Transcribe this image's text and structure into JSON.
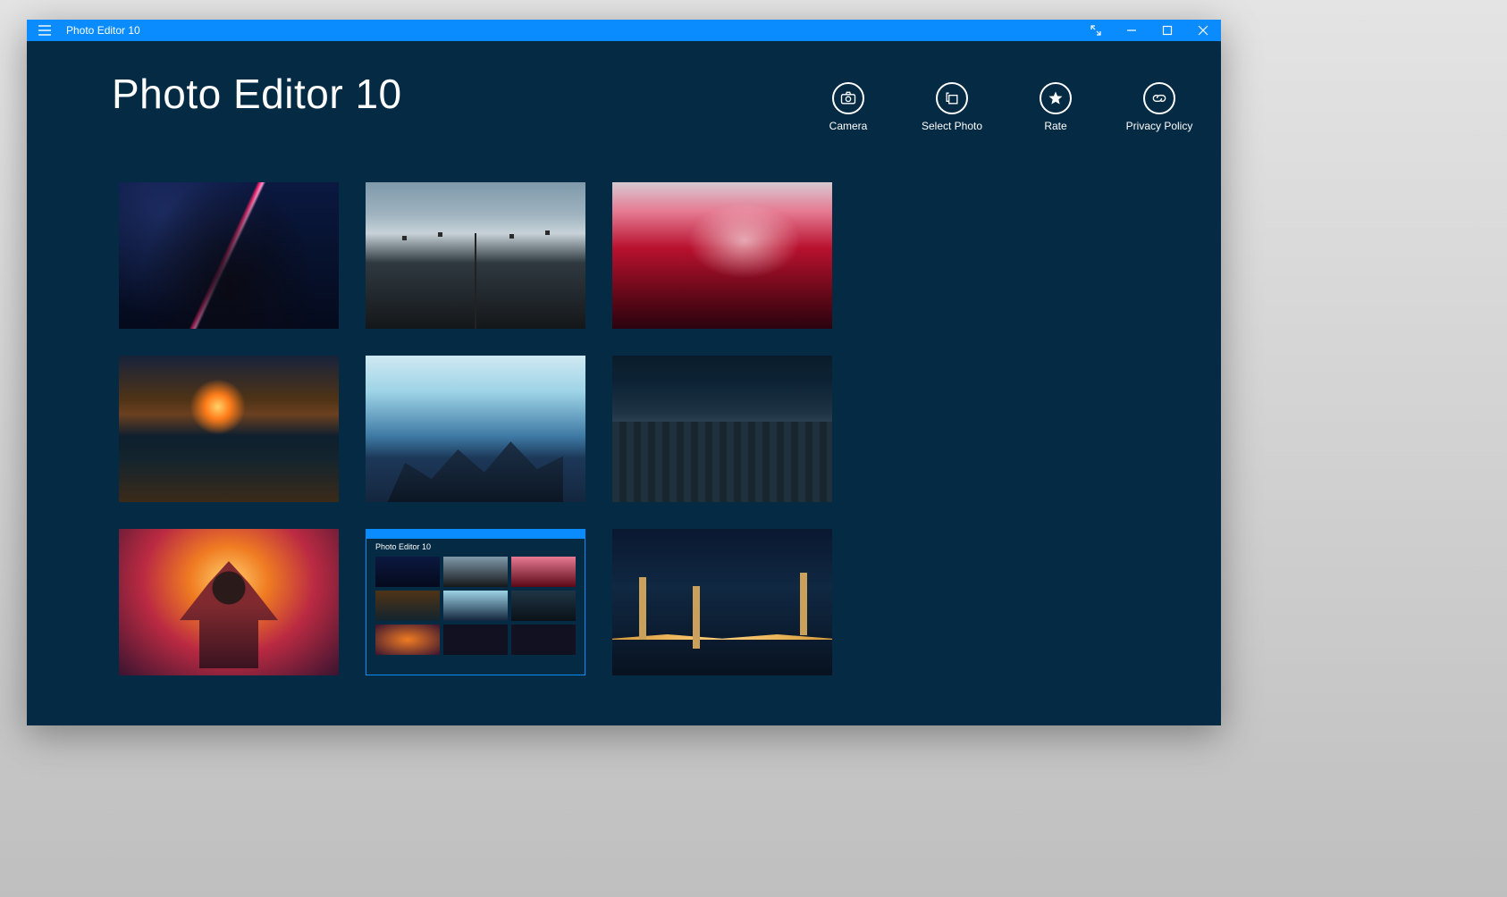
{
  "titlebar": {
    "app_name": "Photo Editor 10"
  },
  "page": {
    "title": "Photo Editor 10"
  },
  "actions": {
    "camera": {
      "label": "Camera"
    },
    "select": {
      "label": "Select Photo"
    },
    "rate": {
      "label": "Rate"
    },
    "privacy": {
      "label": "Privacy Policy"
    }
  },
  "thumbnails": [
    {
      "name": "dark-figure-red-saber"
    },
    {
      "name": "empty-highway-powerlines"
    },
    {
      "name": "red-autumn-foliage"
    },
    {
      "name": "beach-sunset-waves"
    },
    {
      "name": "blue-mountain-ridge"
    },
    {
      "name": "cobblestone-street-evening"
    },
    {
      "name": "polygon-masked-bust"
    },
    {
      "name": "app-self-screenshot"
    },
    {
      "name": "suspension-bridge-night"
    }
  ],
  "nested_screenshot_title": "Photo Editor 10"
}
